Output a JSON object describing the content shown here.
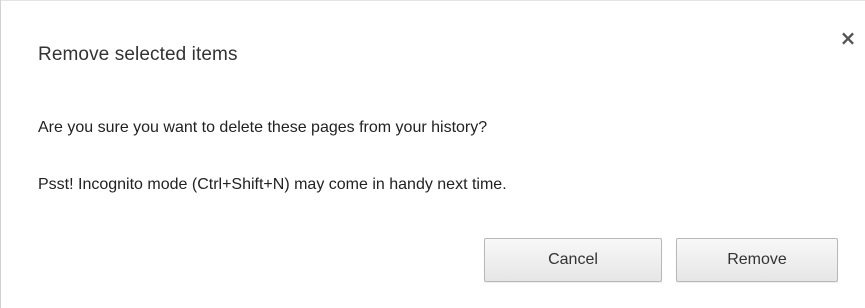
{
  "dialog": {
    "title": "Remove selected items",
    "close_glyph": "×",
    "message_confirm": "Are you sure you want to delete these pages from your history?",
    "message_hint": "Psst! Incognito mode (Ctrl+Shift+N) may come in handy next time.",
    "cancel_label": "Cancel",
    "remove_label": "Remove"
  }
}
